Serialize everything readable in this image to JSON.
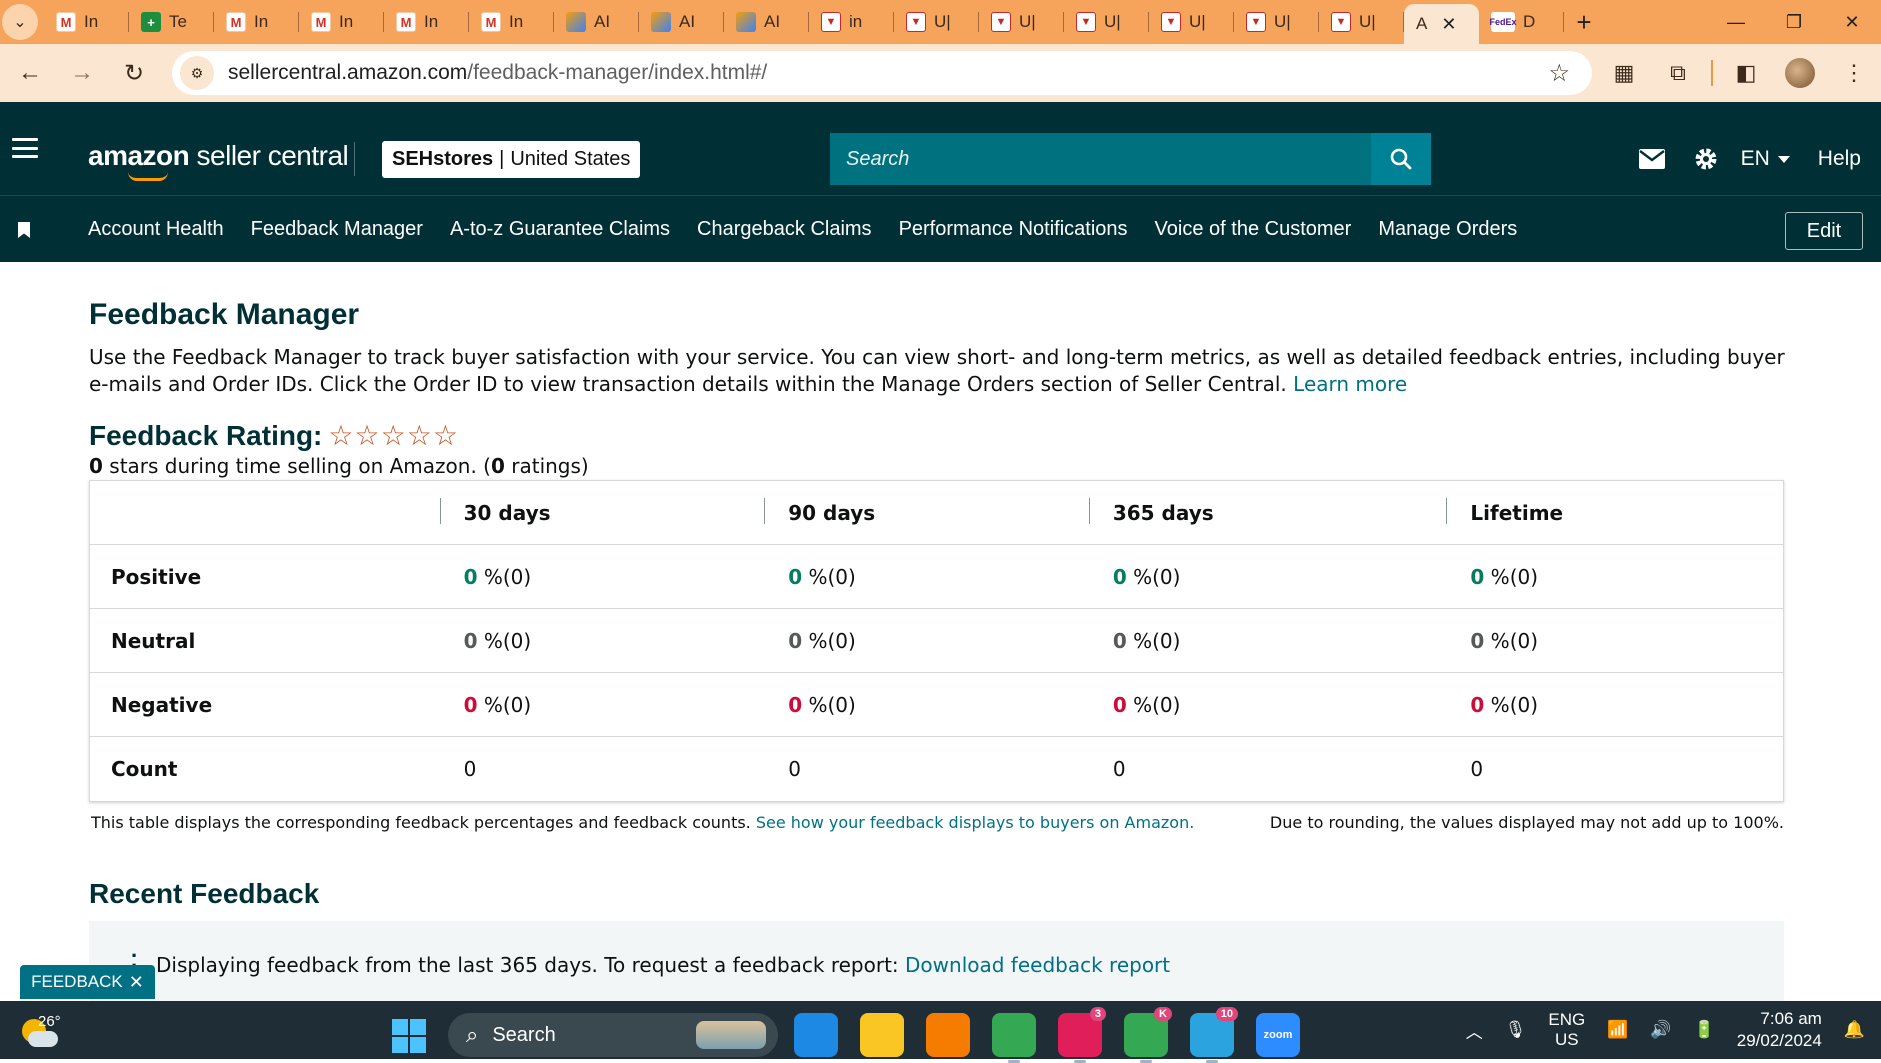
{
  "browser": {
    "tabs": [
      {
        "icon": "gmail-icon",
        "glyph": "M",
        "title": "In"
      },
      {
        "icon": "sheets-icon",
        "glyph": "+",
        "title": "Te"
      },
      {
        "icon": "gmail-icon",
        "glyph": "M",
        "title": "In"
      },
      {
        "icon": "gmail-icon",
        "glyph": "M",
        "title": "In"
      },
      {
        "icon": "gmail-icon",
        "glyph": "M",
        "title": "In"
      },
      {
        "icon": "gmail-icon",
        "glyph": "M",
        "title": "In"
      },
      {
        "icon": "ai-icon",
        "glyph": "",
        "title": "AI"
      },
      {
        "icon": "ai-icon",
        "glyph": "",
        "title": "AI"
      },
      {
        "icon": "ai-icon",
        "glyph": "",
        "title": "AI"
      },
      {
        "icon": "upwork-icon",
        "glyph": "▼",
        "title": "in"
      },
      {
        "icon": "upwork-icon",
        "glyph": "▼",
        "title": "U|"
      },
      {
        "icon": "upwork-icon",
        "glyph": "▼",
        "title": "U|"
      },
      {
        "icon": "upwork-icon",
        "glyph": "▼",
        "title": "U|"
      },
      {
        "icon": "upwork-icon",
        "glyph": "▼",
        "title": "U|"
      },
      {
        "icon": "upwork-icon",
        "glyph": "▼",
        "title": "U|"
      },
      {
        "icon": "upwork-icon",
        "glyph": "▼",
        "title": "U|"
      }
    ],
    "active_tab_title": "A",
    "last_tab": {
      "glyph": "FedEx",
      "title": "D"
    },
    "url_host": "sellercentral.amazon.com",
    "url_path": "/feedback-manager/index.html#/"
  },
  "header": {
    "logo_amazon": "amazon",
    "logo_suffix": "seller central",
    "store_name": "SEHstores",
    "store_sep": "|",
    "store_region": "United States",
    "search_placeholder": "Search",
    "language": "EN",
    "help": "Help"
  },
  "nav": {
    "items": [
      "Account Health",
      "Feedback Manager",
      "A-to-z Guarantee Claims",
      "Chargeback Claims",
      "Performance Notifications",
      "Voice of the Customer",
      "Manage Orders"
    ],
    "edit": "Edit"
  },
  "page": {
    "title": "Feedback Manager",
    "description": "Use the Feedback Manager to track buyer satisfaction with your service. You can view short- and long-term metrics, as well as detailed feedback entries, including buyer e-mails and Order IDs. Click the Order ID to view transaction details within the Manage Orders section of Seller Central.",
    "learn_more": "Learn more",
    "rating_title": "Feedback Rating:",
    "stars_count": 0,
    "rating_stars_value": "0",
    "rating_sub_mid": " stars during time selling on Amazon. (",
    "rating_count": "0",
    "rating_sub_end": " ratings)"
  },
  "table": {
    "columns": [
      "30 days",
      "90 days",
      "365 days",
      "Lifetime"
    ],
    "rows": [
      {
        "label": "Positive",
        "type": "pos",
        "cells": [
          {
            "v": "0",
            "r": " %(0)"
          },
          {
            "v": "0",
            "r": " %(0)"
          },
          {
            "v": "0",
            "r": " %(0)"
          },
          {
            "v": "0",
            "r": " %(0)"
          }
        ]
      },
      {
        "label": "Neutral",
        "type": "neu",
        "cells": [
          {
            "v": "0",
            "r": " %(0)"
          },
          {
            "v": "0",
            "r": " %(0)"
          },
          {
            "v": "0",
            "r": " %(0)"
          },
          {
            "v": "0",
            "r": " %(0)"
          }
        ]
      },
      {
        "label": "Negative",
        "type": "neg",
        "cells": [
          {
            "v": "0",
            "r": " %(0)"
          },
          {
            "v": "0",
            "r": " %(0)"
          },
          {
            "v": "0",
            "r": " %(0)"
          },
          {
            "v": "0",
            "r": " %(0)"
          }
        ]
      },
      {
        "label": "Count",
        "type": "cnt",
        "cells": [
          {
            "v": "",
            "r": "0"
          },
          {
            "v": "",
            "r": "0"
          },
          {
            "v": "",
            "r": "0"
          },
          {
            "v": "",
            "r": "0"
          }
        ]
      }
    ],
    "footnote": "This table displays the corresponding feedback percentages and feedback counts.",
    "footnote_link": "See how your feedback displays to buyers on Amazon.",
    "footnote_right": "Due to rounding, the values displayed may not add up to 100%."
  },
  "recent": {
    "title": "Recent Feedback",
    "info": "Displaying feedback from the last 365 days. To request a feedback report:",
    "download_link": "Download feedback report"
  },
  "feedback_tab": {
    "label": "FEEDBACK",
    "close": "✕"
  },
  "taskbar": {
    "temperature": "26°",
    "search_label": "Search",
    "apps": [
      {
        "name": "edge-icon",
        "label": "",
        "color": "#1e88e5",
        "badge": ""
      },
      {
        "name": "file-explorer-icon",
        "label": "",
        "color": "#f9c623",
        "badge": ""
      },
      {
        "name": "brave-icon",
        "label": "",
        "color": "#f57c00",
        "badge": ""
      },
      {
        "name": "chrome-icon",
        "label": "",
        "color": "#34a853",
        "badge": ""
      },
      {
        "name": "slack-icon",
        "label": "",
        "color": "#e01e5a",
        "badge": "3"
      },
      {
        "name": "chrome-profile-icon",
        "label": "",
        "color": "#34a853",
        "badge": "K"
      },
      {
        "name": "telegram-icon",
        "label": "",
        "color": "#2aa3df",
        "badge": "10"
      },
      {
        "name": "zoom-icon",
        "label": "zoom",
        "color": "#2d8cff",
        "badge": ""
      }
    ],
    "lang_line1": "ENG",
    "lang_line2": "US",
    "time": "7:06 am",
    "date": "29/02/2024"
  },
  "colors": {
    "header_bg": "#002f36",
    "link": "#007185",
    "positive": "#067d62",
    "negative": "#cc0c39",
    "star": "#c7511f",
    "browser_frame": "#f6a35c"
  }
}
